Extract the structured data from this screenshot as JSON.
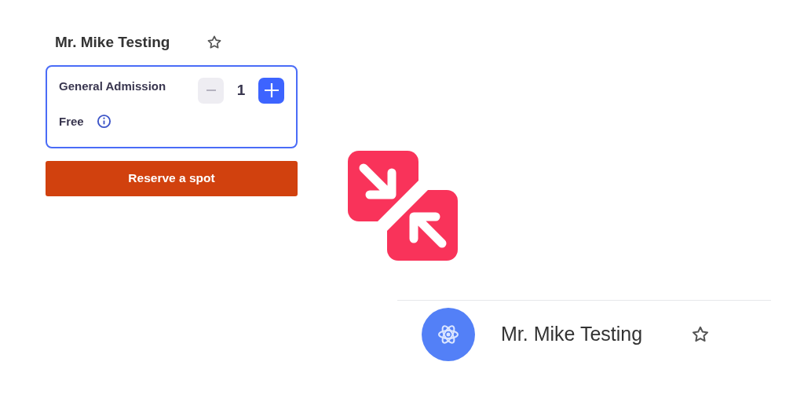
{
  "event_card": {
    "title": "Mr. Mike Testing",
    "starred": false,
    "ticket": {
      "name": "General Admission",
      "price": "Free",
      "quantity": "1",
      "decrement_disabled": true,
      "increment_disabled": false
    },
    "reserve_button": "Reserve a spot"
  },
  "organizer": {
    "name": "Mr. Mike Testing",
    "starred": false
  }
}
